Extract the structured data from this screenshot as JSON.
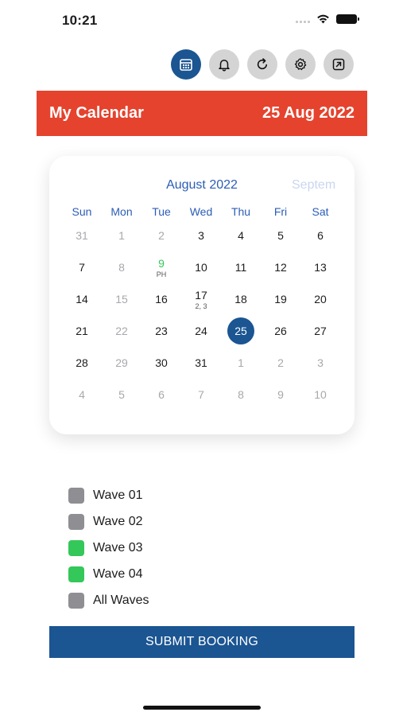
{
  "status_bar": {
    "time": "10:21"
  },
  "toolbar": {
    "buttons": [
      {
        "icon": "calendar-icon",
        "active": true
      },
      {
        "icon": "bell-icon",
        "active": false
      },
      {
        "icon": "refresh-icon",
        "active": false
      },
      {
        "icon": "gear-icon",
        "active": false
      },
      {
        "icon": "export-icon",
        "active": false
      }
    ]
  },
  "header": {
    "title": "My Calendar",
    "date": "25 Aug 2022",
    "color": "#e5432e"
  },
  "calendar": {
    "month_title": "August 2022",
    "next_month_title": "Septem",
    "weekdays": [
      "Sun",
      "Mon",
      "Tue",
      "Wed",
      "Thu",
      "Fri",
      "Sat"
    ],
    "weeks": [
      [
        {
          "d": "31",
          "muted": true
        },
        {
          "d": "1",
          "muted": true
        },
        {
          "d": "2",
          "muted": true
        },
        {
          "d": "3"
        },
        {
          "d": "4"
        },
        {
          "d": "5"
        },
        {
          "d": "6"
        }
      ],
      [
        {
          "d": "7"
        },
        {
          "d": "8",
          "muted": true
        },
        {
          "d": "9",
          "holiday": true,
          "sub": "PH"
        },
        {
          "d": "10"
        },
        {
          "d": "11"
        },
        {
          "d": "12"
        },
        {
          "d": "13"
        }
      ],
      [
        {
          "d": "14"
        },
        {
          "d": "15",
          "muted": true
        },
        {
          "d": "16"
        },
        {
          "d": "17",
          "sub": "2, 3"
        },
        {
          "d": "18"
        },
        {
          "d": "19"
        },
        {
          "d": "20"
        }
      ],
      [
        {
          "d": "21"
        },
        {
          "d": "22",
          "muted": true
        },
        {
          "d": "23"
        },
        {
          "d": "24"
        },
        {
          "d": "25",
          "selected": true
        },
        {
          "d": "26"
        },
        {
          "d": "27"
        }
      ],
      [
        {
          "d": "28"
        },
        {
          "d": "29",
          "muted": true
        },
        {
          "d": "30"
        },
        {
          "d": "31"
        },
        {
          "d": "1",
          "muted": true
        },
        {
          "d": "2",
          "muted": true
        },
        {
          "d": "3",
          "muted": true
        }
      ],
      [
        {
          "d": "4",
          "muted": true
        },
        {
          "d": "5",
          "muted": true
        },
        {
          "d": "6",
          "muted": true
        },
        {
          "d": "7",
          "muted": true
        },
        {
          "d": "8",
          "muted": true
        },
        {
          "d": "9",
          "muted": true
        },
        {
          "d": "10",
          "muted": true
        }
      ]
    ]
  },
  "legend": [
    {
      "label": "Wave 01",
      "color": "#8e8e93"
    },
    {
      "label": "Wave 02",
      "color": "#8e8e93"
    },
    {
      "label": "Wave 03",
      "color": "#34c759"
    },
    {
      "label": "Wave 04",
      "color": "#34c759"
    },
    {
      "label": "All Waves",
      "color": "#8e8e93"
    }
  ],
  "submit": {
    "label": "SUBMIT BOOKING",
    "color": "#1b5592"
  }
}
